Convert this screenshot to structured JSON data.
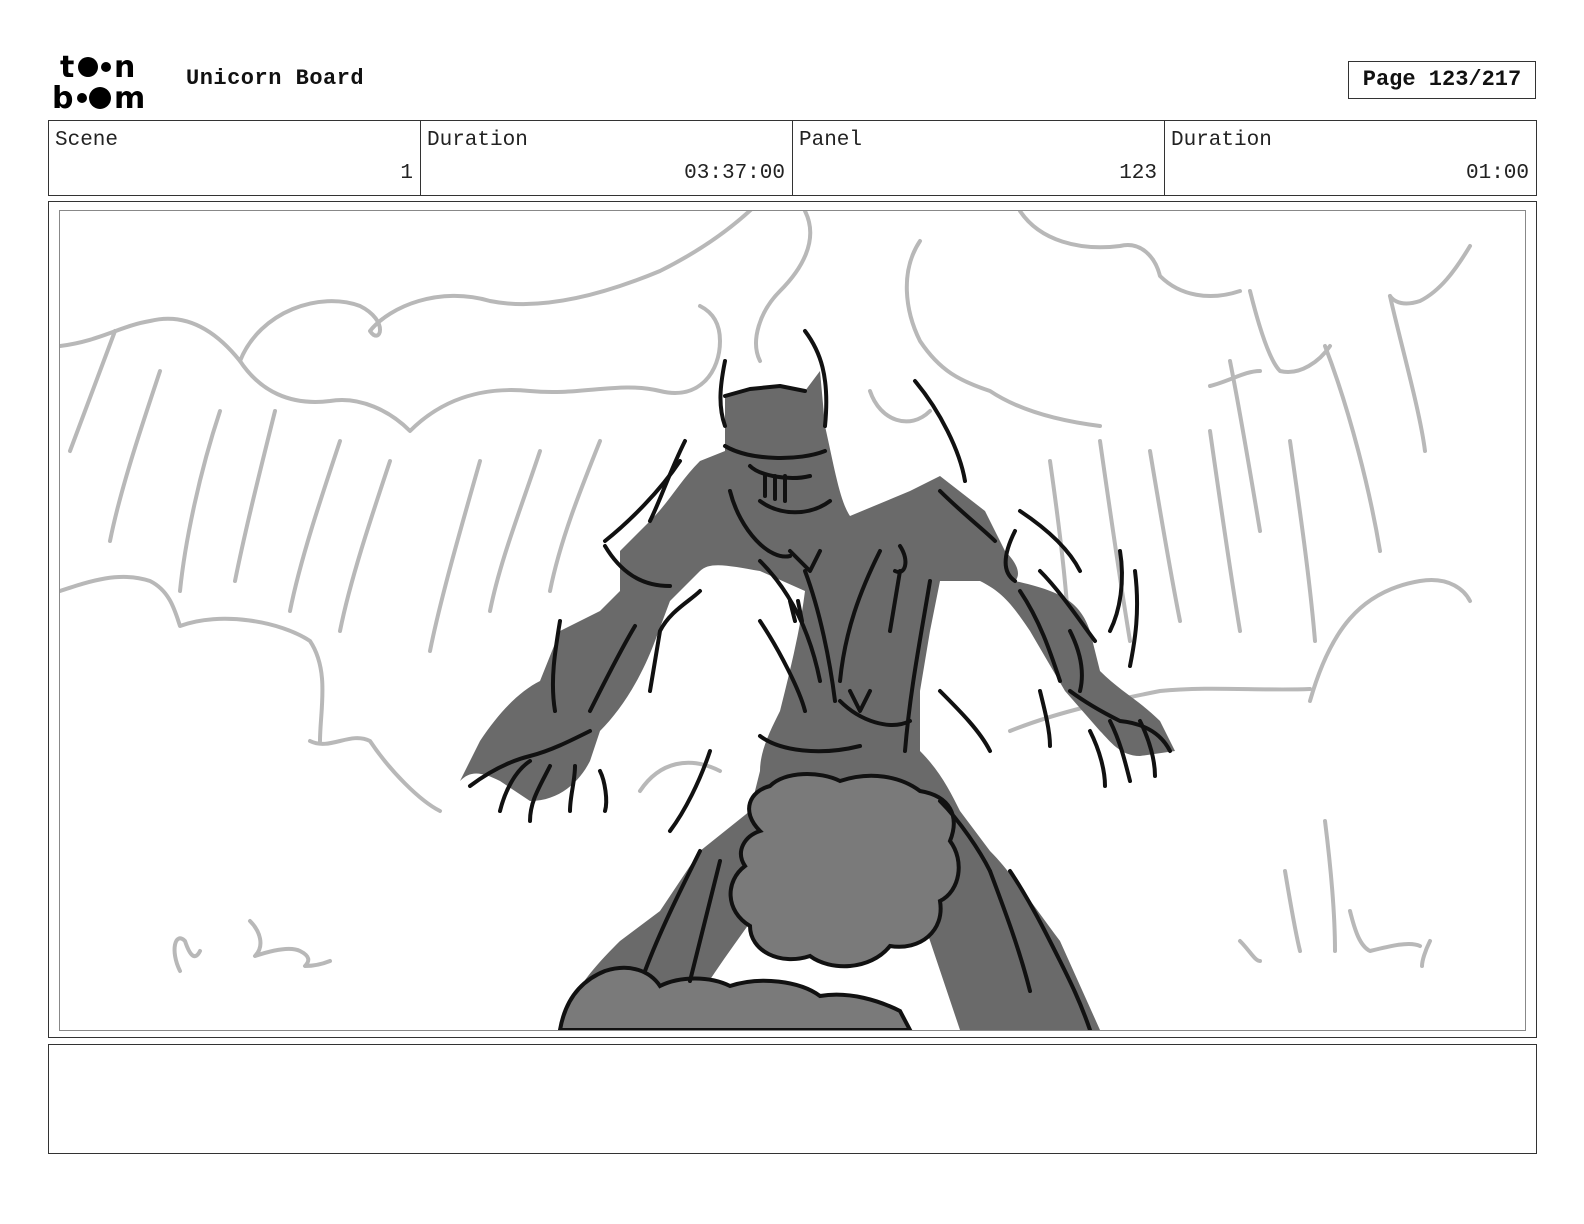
{
  "header": {
    "logo": {
      "icon": "toon-boom-logo",
      "line1": "toon",
      "line2": "boom"
    },
    "board_title": "Unicorn Board",
    "page_label": "Page 123/217"
  },
  "info": [
    {
      "label": "Scene",
      "value": "1"
    },
    {
      "label": "Duration",
      "value": "03:37:00"
    },
    {
      "label": "Panel",
      "value": "123"
    },
    {
      "label": "Duration",
      "value": "01:00"
    }
  ],
  "panel": {
    "image_description": "storyboard-sketch-armored-knight-with-claws",
    "colors": {
      "background_lines": "#b8b8b8",
      "fill": "#6a6a6a",
      "ink": "#111111"
    }
  },
  "notes": {
    "text": ""
  }
}
